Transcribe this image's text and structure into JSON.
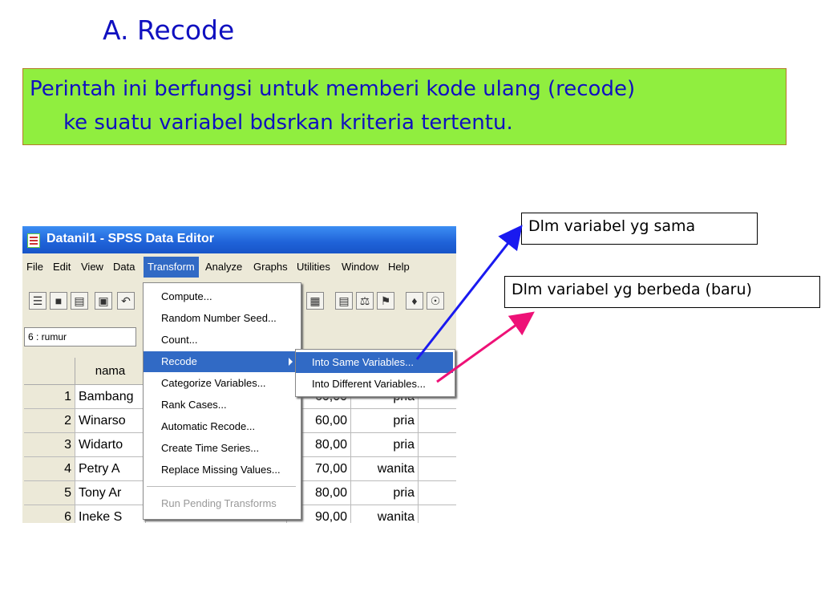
{
  "slide": {
    "title": "A. Recode",
    "description_line1": "Perintah ini berfungsi untuk memberi kode ulang (recode)",
    "description_line2": "ke suatu variabel bdsrkan kriteria tertentu.",
    "callout_same": "Dlm variabel yg sama",
    "callout_different": "Dlm variabel yg berbeda (baru)"
  },
  "window": {
    "title": "Datanil1 - SPSS Data Editor",
    "menu": [
      "File",
      "Edit",
      "View",
      "Data",
      "Transform",
      "Analyze",
      "Graphs",
      "Utilities",
      "Window",
      "Help"
    ],
    "active_menu": "Transform",
    "cell_reference": "6 : rumur"
  },
  "transform_menu": {
    "items": [
      "Compute...",
      "Random Number Seed...",
      "Count...",
      "Recode",
      "Categorize Variables...",
      "Rank Cases...",
      "Automatic Recode...",
      "Create Time Series...",
      "Replace Missing Values..."
    ],
    "selected": "Recode",
    "disabled_item": "Run Pending Transforms"
  },
  "recode_submenu": {
    "items": [
      "Into Same Variables...",
      "Into Different Variables..."
    ],
    "selected": "Into Same Variables..."
  },
  "grid": {
    "column_header": "nama",
    "rows": [
      {
        "n": "1",
        "nama": "Bambang",
        "val": "60,00",
        "sex": "pria"
      },
      {
        "n": "2",
        "nama": "Winarso",
        "val": "60,00",
        "sex": "pria"
      },
      {
        "n": "3",
        "nama": "Widarto",
        "val": "80,00",
        "sex": "pria"
      },
      {
        "n": "4",
        "nama": "Petry A",
        "val": "70,00",
        "sex": "wanita"
      },
      {
        "n": "5",
        "nama": "Tony Ar",
        "val": "80,00",
        "sex": "pria"
      },
      {
        "n": "6",
        "nama": "Ineke S",
        "val": "90,00",
        "sex": "wanita"
      }
    ]
  },
  "colors": {
    "title_text": "#1010c0",
    "green_box": "#90ee3f",
    "arrow_blue": "#1a1af0",
    "arrow_pink": "#ee1177",
    "menu_highlight": "#316ac5"
  }
}
